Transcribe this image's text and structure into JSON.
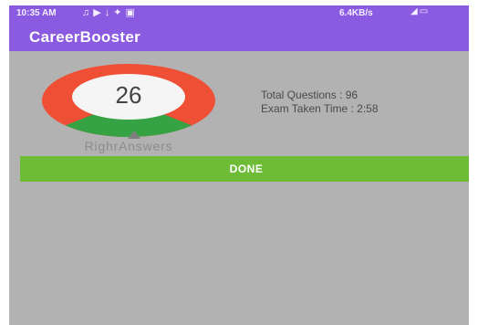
{
  "status_bar": {
    "time": "10:35 AM",
    "network_speed": "6.4KB/s",
    "left_icons": [
      "tiktok-icon",
      "send-icon",
      "download-icon",
      "app-icon",
      "bag-icon"
    ],
    "right_icons": [
      "volte-icon",
      "signal-icon",
      "battery-icon"
    ]
  },
  "app_bar": {
    "title": "CareerBooster"
  },
  "result": {
    "score": "26",
    "caption": "RighrAnswers",
    "correct_fraction": 0.26,
    "colors": {
      "correct": "#35a244",
      "wrong": "#ef4f35",
      "center": "#f5f5f5"
    }
  },
  "stats": {
    "total_questions": "Total Questions : 96",
    "exam_time": "Exam Taken Time : 2:58"
  },
  "done_button": {
    "label": "DONE"
  },
  "theme": {
    "primary": "#8a5be0",
    "accent": "#6ebc36",
    "background": "#b2b2b2"
  }
}
